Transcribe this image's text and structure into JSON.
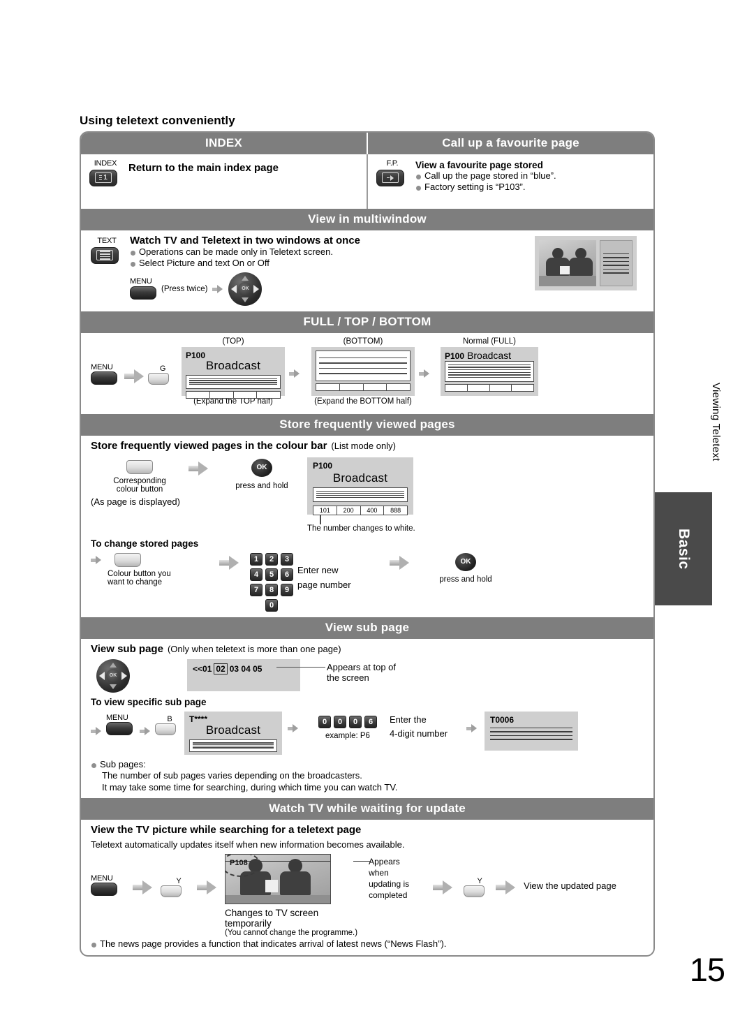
{
  "page": {
    "heading": "Using teletext conveniently",
    "number": "15",
    "side_tab_chapter": "Viewing Teletext",
    "side_tab_section": "Basic"
  },
  "section_index": {
    "title_left": "INDEX",
    "title_right": "Call up a favourite page",
    "left": {
      "key_label": "INDEX",
      "key_icon": "teletext-index-icon",
      "heading": "Return to the main index page"
    },
    "right": {
      "key_label": "F.P.",
      "key_icon": "favourite-page-icon",
      "heading": "View a favourite page stored",
      "bullets": [
        "Call up the page stored in “blue”.",
        "Factory setting is “P103”."
      ]
    }
  },
  "section_multiwindow": {
    "title": "View in multiwindow",
    "key_label": "TEXT",
    "key_icon": "teletext-icon",
    "heading": "Watch TV and Teletext in two windows at once",
    "bullets": [
      "Operations can be made only in Teletext screen.",
      "Select Picture and text On or Off"
    ],
    "steps": {
      "menu_label": "MENU",
      "press_twice": "(Press twice)",
      "dpad_label": "OK"
    }
  },
  "section_full_top_bottom": {
    "title": "FULL / TOP / BOTTOM",
    "menu_label": "MENU",
    "colour_key": "G",
    "screens": [
      {
        "caption_top": "(TOP)",
        "page_no": "P100",
        "broadcast": "Broadcast",
        "caption_bottom": "(Expand the TOP half)"
      },
      {
        "caption_top": "(BOTTOM)",
        "page_no": "",
        "broadcast": "",
        "caption_bottom": "(Expand the BOTTOM half)"
      },
      {
        "caption_top": "Normal (FULL)",
        "page_no": "P100",
        "broadcast": "Broadcast",
        "caption_bottom": ""
      }
    ]
  },
  "section_store": {
    "title": "Store frequently viewed pages",
    "heading_bold": "Store frequently viewed pages in the colour bar",
    "heading_note": "(List mode only)",
    "step1_label_line1": "Corresponding",
    "step1_label_line2": "colour button",
    "step1_note": "(As page is displayed)",
    "ok_key": "OK",
    "ok_caption": "press and hold",
    "screen": {
      "page_no": "P100",
      "broadcast": "Broadcast",
      "colour_bar": [
        "101",
        "200",
        "400",
        "888"
      ]
    },
    "screen_caption": "The number changes to white.",
    "change": {
      "heading": "To change stored pages",
      "colour_button_line1": "Colour button you",
      "colour_button_line2": "want to change",
      "keypad": [
        "1",
        "2",
        "3",
        "4",
        "5",
        "6",
        "7",
        "8",
        "9",
        "0"
      ],
      "enter_line1": "Enter new",
      "enter_line2": "page number",
      "ok_key": "OK",
      "ok_caption": "press and hold"
    }
  },
  "section_subpage": {
    "title": "View sub page",
    "heading_bold": "View sub page",
    "heading_note": "(Only when teletext is more than one page)",
    "subpage_bar": {
      "prefix": "<<01",
      "selected": "02",
      "rest": "03 04 05"
    },
    "callout_line1": "Appears at top of",
    "callout_line2": "the screen",
    "specific": {
      "heading": "To view specific sub page",
      "menu_label": "MENU",
      "colour_key": "B",
      "screen": {
        "page_no": "T****",
        "broadcast": "Broadcast"
      },
      "keypad": [
        "0",
        "0",
        "0",
        "6"
      ],
      "example": "example: P6",
      "enter_line1": "Enter the",
      "enter_line2": "4-digit number",
      "result_screen": {
        "page_no": "T0006"
      }
    },
    "notes": [
      "Sub pages:",
      "The number of sub pages varies depending on the broadcasters.",
      "It may take some time for searching, during which time you can watch TV."
    ]
  },
  "section_watch_update": {
    "title": "Watch TV while waiting for update",
    "heading": "View the TV picture while searching for a teletext page",
    "intro": "Teletext automatically updates itself when new information becomes available.",
    "menu_label": "MENU",
    "colour_key_1": "Y",
    "colour_key_2": "Y",
    "tv_page_no": "P108",
    "callout": [
      "Appears",
      "when",
      "updating is",
      "completed"
    ],
    "tv_caption_bold": "Changes to TV screen temporarily",
    "tv_caption_note": "(You cannot change the programme.)",
    "result_text": "View the updated page",
    "footer_bullet": "The news page provides a function that indicates arrival of latest news (“News Flash”)."
  },
  "colors": {
    "band": "#7e7e7e",
    "border": "#8a8a8a",
    "side_tab": "#4a4a4a",
    "screen_bg": "#cfcfcf"
  }
}
